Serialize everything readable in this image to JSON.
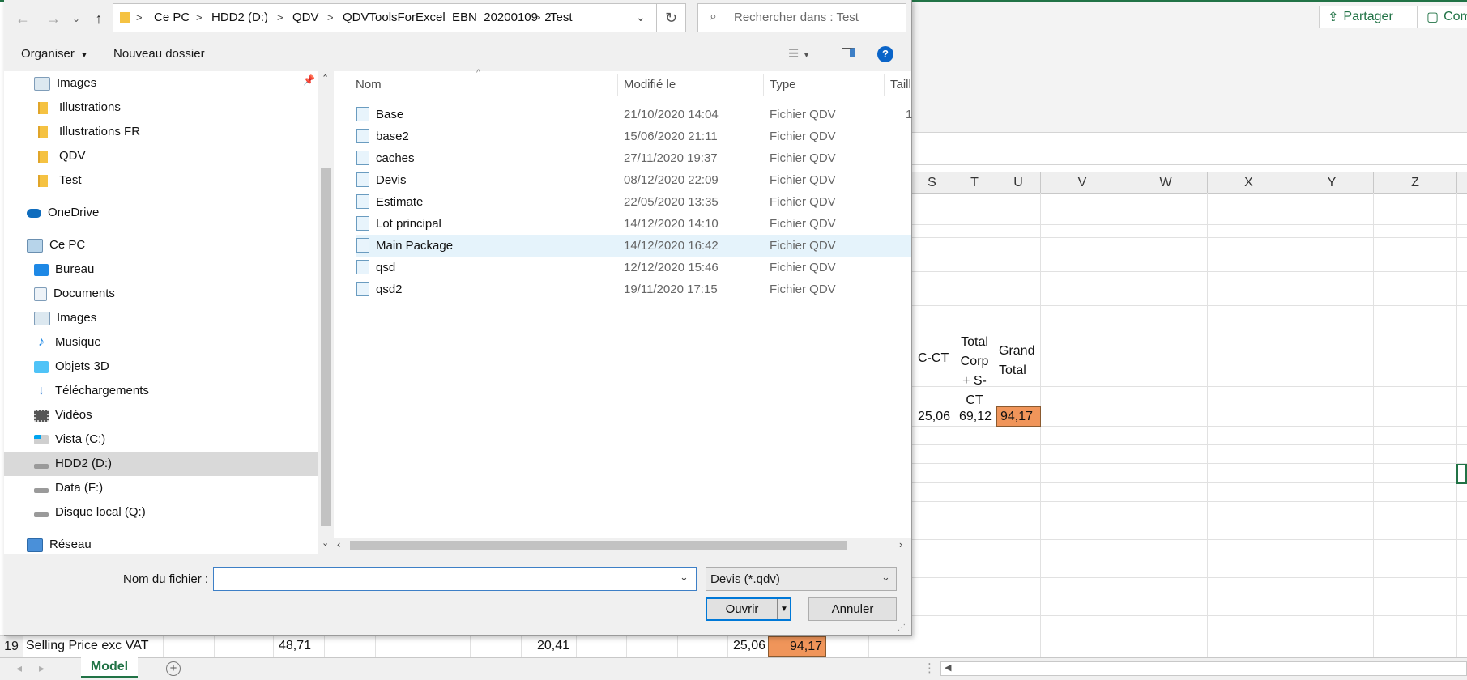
{
  "excel": {
    "share_label": "Partager",
    "comments_label": "Com",
    "columns": [
      "S",
      "T",
      "U",
      "V",
      "W",
      "X",
      "Y",
      "Z"
    ],
    "header_cells": {
      "s": "C-CT",
      "t": "Total Corp + S-CT",
      "u": "Grand Total"
    },
    "value_row": {
      "s": "25,06",
      "t": "69,12",
      "u": "94,17"
    },
    "row19": {
      "num": "19",
      "label": "Selling Price  exc VAT",
      "v1": "48,71",
      "v2": "20,41",
      "v3": "25,06",
      "v4": "94,17"
    },
    "sheet_tab": "Model"
  },
  "dialog": {
    "breadcrumb": [
      "Ce PC",
      "HDD2 (D:)",
      "QDV",
      "QDVToolsForExcel_EBN_20200109_2",
      "Test"
    ],
    "search_placeholder": "Rechercher dans : Test",
    "toolbar": {
      "organize": "Organiser",
      "new_folder": "Nouveau dossier"
    },
    "nav": [
      {
        "label": "Images",
        "icon": "images-icon"
      },
      {
        "label": "Illustrations",
        "icon": "folder-icon"
      },
      {
        "label": "Illustrations FR",
        "icon": "folder-icon"
      },
      {
        "label": "QDV",
        "icon": "folder-icon"
      },
      {
        "label": "Test",
        "icon": "folder-icon"
      },
      {
        "label": "OneDrive",
        "icon": "onedrive-icon"
      },
      {
        "label": "Ce PC",
        "icon": "pc-icon"
      },
      {
        "label": "Bureau",
        "icon": "desktop-icon"
      },
      {
        "label": "Documents",
        "icon": "documents-icon"
      },
      {
        "label": "Images",
        "icon": "images-icon"
      },
      {
        "label": "Musique",
        "icon": "music-icon"
      },
      {
        "label": "Objets 3D",
        "icon": "objects3d-icon"
      },
      {
        "label": "Téléchargements",
        "icon": "downloads-icon"
      },
      {
        "label": "Vidéos",
        "icon": "videos-icon"
      },
      {
        "label": "Vista (C:)",
        "icon": "drive-windows-icon"
      },
      {
        "label": "HDD2 (D:)",
        "icon": "drive-icon"
      },
      {
        "label": "Data (F:)",
        "icon": "drive-icon"
      },
      {
        "label": "Disque local (Q:)",
        "icon": "drive-icon"
      },
      {
        "label": "Réseau",
        "icon": "network-icon"
      }
    ],
    "columns": {
      "name": "Nom",
      "modified": "Modifié le",
      "type": "Type",
      "size": "Taille"
    },
    "files": [
      {
        "name": "Base",
        "modified": "21/10/2020 14:04",
        "type": "Fichier QDV",
        "size": "1"
      },
      {
        "name": "base2",
        "modified": "15/06/2020 21:11",
        "type": "Fichier QDV"
      },
      {
        "name": "caches",
        "modified": "27/11/2020 19:37",
        "type": "Fichier QDV"
      },
      {
        "name": "Devis",
        "modified": "08/12/2020 22:09",
        "type": "Fichier QDV"
      },
      {
        "name": "Estimate",
        "modified": "22/05/2020 13:35",
        "type": "Fichier QDV"
      },
      {
        "name": "Lot principal",
        "modified": "14/12/2020 14:10",
        "type": "Fichier QDV"
      },
      {
        "name": "Main Package",
        "modified": "14/12/2020 16:42",
        "type": "Fichier QDV"
      },
      {
        "name": "qsd",
        "modified": "12/12/2020 15:46",
        "type": "Fichier QDV"
      },
      {
        "name": "qsd2",
        "modified": "19/11/2020 17:15",
        "type": "Fichier QDV"
      }
    ],
    "filename_label": "Nom du fichier :",
    "filename_value": "",
    "filetype_value": "Devis (*.qdv)",
    "open_label": "Ouvrir",
    "cancel_label": "Annuler"
  }
}
